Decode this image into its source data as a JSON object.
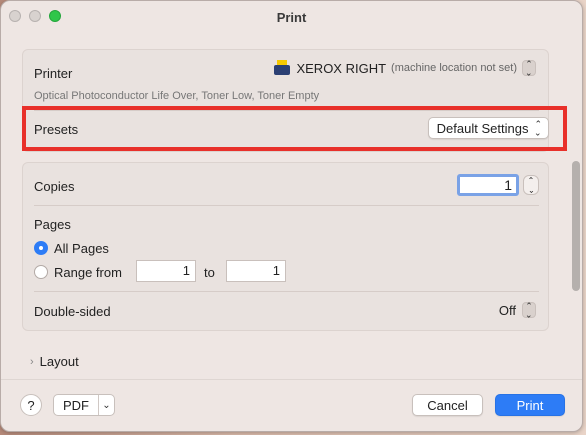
{
  "window": {
    "title": "Print"
  },
  "printer": {
    "label": "Printer",
    "name": "XEROX RIGHT",
    "location": "(machine location not set)",
    "status": "Optical Photoconductor Life Over, Toner Low, Toner Empty"
  },
  "presets": {
    "label": "Presets",
    "value": "Default Settings"
  },
  "copies": {
    "label": "Copies",
    "value": "1"
  },
  "pages": {
    "label": "Pages",
    "all_label": "All Pages",
    "range_label": "Range from",
    "to_label": "to",
    "from_value": "1",
    "to_value": "1",
    "selected": "all"
  },
  "double_sided": {
    "label": "Double-sided",
    "value": "Off"
  },
  "layout": {
    "label": "Layout"
  },
  "footer": {
    "help_label": "?",
    "pdf_label": "PDF",
    "cancel_label": "Cancel",
    "print_label": "Print"
  },
  "colors": {
    "accent": "#2d7cf6",
    "highlight": "#e8302a"
  },
  "icons": {
    "printer": "printer-icon",
    "updown": "updown-chevron-icon",
    "disclosure": "chevron-right-icon",
    "pdf_menu": "chevron-down-icon"
  }
}
